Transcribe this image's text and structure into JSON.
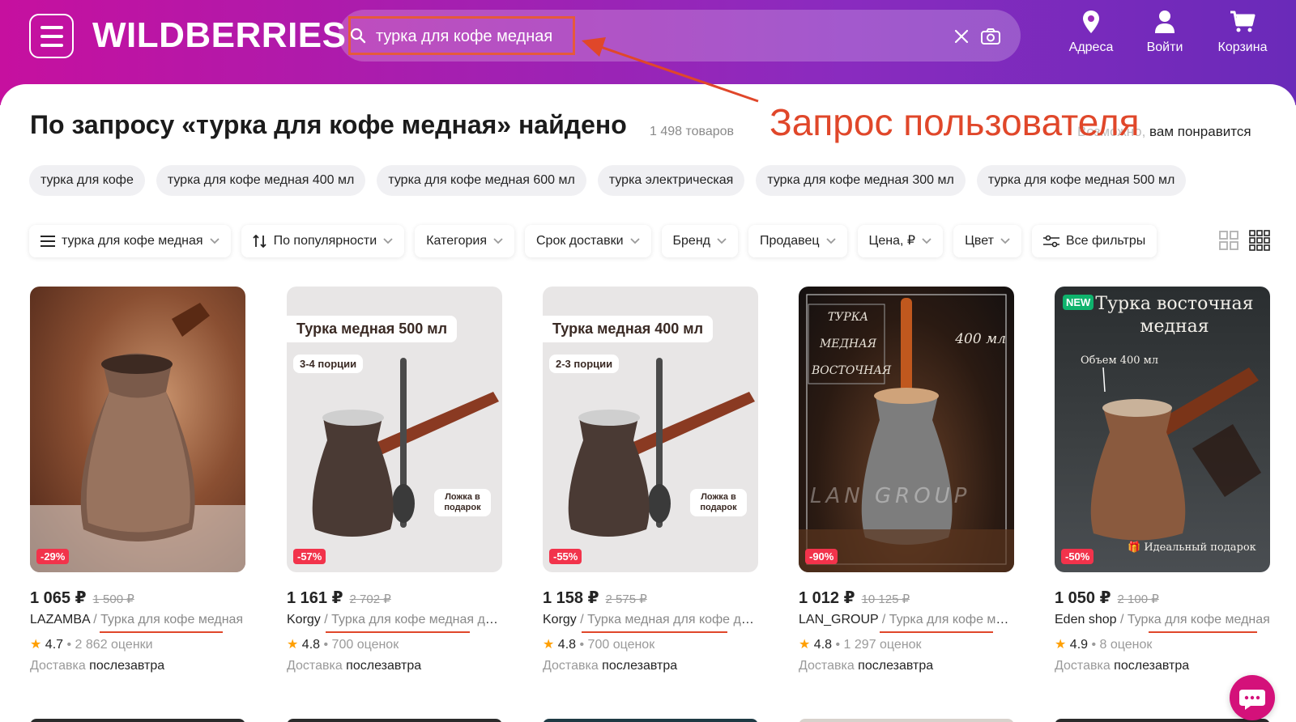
{
  "header": {
    "logo": "WILDBERRIES",
    "search": {
      "value": "турка для кофе медная",
      "placeholder": "турка для кофе медная"
    },
    "buttons": [
      {
        "label": "Адреса",
        "icon": "location-pin-icon"
      },
      {
        "label": "Войти",
        "icon": "user-icon"
      },
      {
        "label": "Корзина",
        "icon": "cart-icon"
      }
    ]
  },
  "results": {
    "title": "По запросу «турка для кофе медная» найдено",
    "count": "1 498 товаров",
    "maybe_prefix": "Возможно,",
    "maybe_suffix": "вам понравится"
  },
  "annotation": "Запрос пользователя",
  "chips": [
    "турка для кофе",
    "турка для кофе медная 400 мл",
    "турка для кофе медная 600 мл",
    "турка электрическая",
    "турка для кофе медная 300 мл",
    "турка для кофе медная 500 мл"
  ],
  "filters": {
    "query": "турка для кофе медная",
    "sort": "По популярности",
    "category": "Категория",
    "delivery": "Срок доставки",
    "brand": "Бренд",
    "seller": "Продавец",
    "price": "Цена, ₽",
    "color": "Цвет",
    "all": "Все фильтры"
  },
  "products": [
    {
      "discount": "-29%",
      "price": "1 065 ₽",
      "old_price": "1 500 ₽",
      "brand": "LAZAMBA",
      "title": "Турка для кофе медная",
      "rating": "4.7",
      "reviews": "2 862 оценки",
      "delivery_label": "Доставка",
      "delivery_when": "послезавтра"
    },
    {
      "discount": "-57%",
      "price": "1 161 ₽",
      "old_price": "2 702 ₽",
      "brand": "Korgy",
      "title": "Турка для кофе медная для плиты",
      "rating": "4.8",
      "reviews": "700 оценок",
      "delivery_label": "Доставка",
      "delivery_when": "послезавтра",
      "img_label": "Турка медная 500 мл",
      "img_sub": "3-4 порции",
      "img_spoon": "Ложка в подарок"
    },
    {
      "discount": "-55%",
      "price": "1 158 ₽",
      "old_price": "2 575 ₽",
      "brand": "Korgy",
      "title": "Турка медная для кофе для плиты",
      "rating": "4.8",
      "reviews": "700 оценок",
      "delivery_label": "Доставка",
      "delivery_when": "послезавтра",
      "img_label": "Турка медная 400 мл",
      "img_sub": "2-3 порции",
      "img_spoon": "Ложка в подарок"
    },
    {
      "discount": "-90%",
      "price": "1 012 ₽",
      "old_price": "10 125 ₽",
      "brand": "LAN_GROUP",
      "title": "Турка для кофе медная",
      "rating": "4.8",
      "reviews": "1 297 оценок",
      "delivery_label": "Доставка",
      "delivery_when": "послезавтра",
      "img_lines": [
        "ТУРКА",
        "МЕДНАЯ",
        "ВОСТОЧНАЯ"
      ],
      "img_volume": "400 мл",
      "img_watermark": "LAN GROUP"
    },
    {
      "discount": "-50%",
      "price": "1 050 ₽",
      "old_price": "2 100 ₽",
      "brand": "Eden shop",
      "title": "Турка для кофе медная",
      "rating": "4.9",
      "reviews": "8 оценок",
      "delivery_label": "Доставка",
      "delivery_when": "послезавтра",
      "img_new": "NEW",
      "img_title": "Турка восточная медная",
      "img_volume": "Объем 400 мл",
      "img_gift": "Идеальный подарок"
    }
  ],
  "colors": {
    "accent": "#cb11ab",
    "annotation": "#e0472a",
    "discount": "#f2334b",
    "star": "#ff9f00"
  }
}
